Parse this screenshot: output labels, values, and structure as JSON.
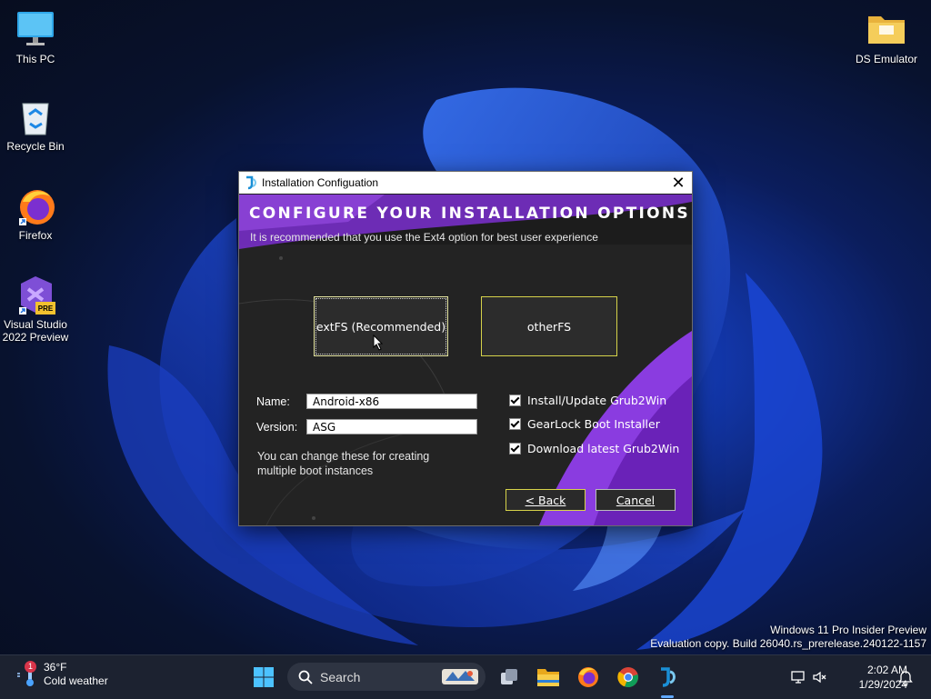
{
  "desktop": {
    "icons": [
      {
        "label": "This PC"
      },
      {
        "label": "Recycle Bin"
      },
      {
        "label": "Firefox"
      },
      {
        "label": "Visual Studio 2022 Preview",
        "badge": "PRE"
      },
      {
        "label": "DS Emulator"
      }
    ]
  },
  "dialog": {
    "title": "Installation Configuation",
    "heading": "CONFIGURE YOUR INSTALLATION OPTIONS",
    "subtext": "It is recommended that you use the Ext4 option for best user experience",
    "fs_buttons": {
      "ext": "extFS (Recommended)",
      "other": "otherFS"
    },
    "name_label": "Name:",
    "name_value": "Android-x86",
    "version_label": "Version:",
    "version_value": "ASG",
    "note": "You can change these for creating multiple boot instances",
    "checkboxes": [
      {
        "label": "Install/Update Grub2Win",
        "checked": true
      },
      {
        "label": "GearLock Boot Installer",
        "checked": true
      },
      {
        "label": "Download latest Grub2Win",
        "checked": true
      }
    ],
    "back_label": "< Back",
    "cancel_label": "Cancel"
  },
  "watermark": {
    "line1": "Windows 11 Pro Insider Preview",
    "line2": "Evaluation copy. Build 26040.rs_prerelease.240122-1157"
  },
  "taskbar": {
    "weather_temp": "36°F",
    "weather_desc": "Cold weather",
    "weather_badge": "1",
    "search_placeholder": "Search",
    "time": "2:02 AM",
    "date": "1/29/2024"
  },
  "colors": {
    "accent_purple": "#7b2fd0",
    "button_border_yellow": "#d6d34a",
    "taskbar_bg": "#1c2230"
  }
}
